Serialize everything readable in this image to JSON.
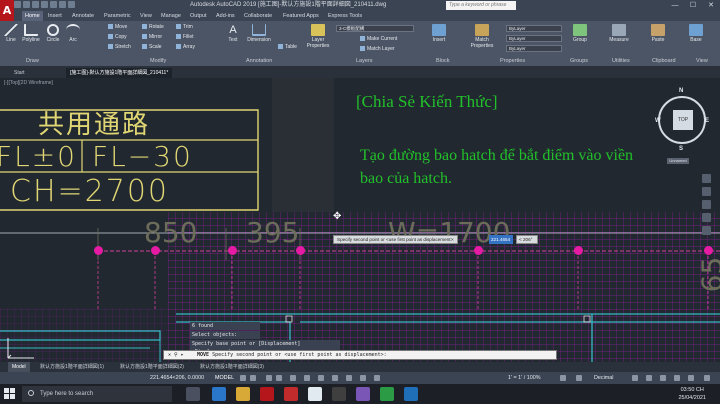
{
  "app": {
    "logo": "A",
    "title": "Autodesk AutoCAD 2019   [施工图]-默认方施設1階平面詳細図_210411.dwg",
    "search_placeholder": "Type a keyword or phrase",
    "window_controls": [
      "—",
      "☐",
      "✕"
    ]
  },
  "ribbon_tabs": [
    "Home",
    "Insert",
    "Annotate",
    "Parametric",
    "View",
    "Manage",
    "Output",
    "Add-ins",
    "Collaborate",
    "Featured Apps",
    "Express Tools"
  ],
  "ribbon": {
    "draw_tools": [
      "Line",
      "Polyline",
      "Circle",
      "Arc"
    ],
    "modify_tools": [
      "Move",
      "Rotate",
      "Trim",
      "Copy",
      "Mirror",
      "Fillet",
      "Stretch",
      "Scale",
      "Array"
    ],
    "annotation_tools": [
      "Text",
      "Dimension",
      "Table"
    ],
    "layer_tools": [
      "Layer Properties",
      "Make Current",
      "Match Layer"
    ],
    "layer_current": "3-C模板配構",
    "block_tool": "Insert",
    "properties_tool": "Match Properties",
    "bylayer": [
      "ByLayer",
      "ByLayer",
      "ByLayer"
    ],
    "group_tool": "Group",
    "utility_tool": "Measure",
    "clipboard_tool": "Paste",
    "base_tool": "Base",
    "panels": [
      "Draw",
      "Modify",
      "Annotation",
      "Layers",
      "Block",
      "Properties",
      "Groups",
      "Utilities",
      "Clipboard",
      "View"
    ]
  },
  "file_tabs": [
    "Start",
    "[施工图]-默认方施設1階平面詳細図_210411*"
  ],
  "drawing": {
    "view_label": "[-][Top][2D Wireframe]",
    "cad_title": "共用通路",
    "cad_fl0": "FL±0",
    "cad_fl30": "FL−30",
    "cad_ch": "CH=2700",
    "dim_850": "850",
    "dim_395": "395",
    "dim_w": "W=1700",
    "dim_65": "65",
    "annotation_title": "[Chia Sẻ Kiến Thức]",
    "annotation_body": "Tạo đường bao hatch để bắt điểm vào viền bao của hatch.",
    "viewcube": {
      "top": "TOP",
      "n": "N",
      "s": "S",
      "e": "E",
      "w": "W"
    },
    "wcs": "Unnamed",
    "tooltip": "Specify second point or <use first point as displacement>:",
    "dyn_distance": "221.4654",
    "dyn_angle": "< 206°"
  },
  "command_history": [
    "6 found",
    "Select objects:",
    "Specify base point or [Displacement] <Displacement>:"
  ],
  "command_line": {
    "command": "MOVE",
    "prompt": "Specify second point or <use first point as displacement>:"
  },
  "layout_tabs": [
    "Model",
    "默认方施設1階平面詳細図(1)",
    "默认方施設1階平面詳細図(2)",
    "默认方施設1階平面詳細図(3)"
  ],
  "status": {
    "coords": "221.4654<206, 0.0000",
    "model": "MODEL",
    "scale": "1' = 1'",
    "zoom": "100%",
    "units": "Decimal"
  },
  "taskbar": {
    "search": "Type here to search",
    "time": "03:50 CH",
    "date": "25/04/2021"
  },
  "colors": {
    "annotation": "#22c02a",
    "cad_text": "#e0d673",
    "grip": "#e51ba4",
    "hatch": "#b21fb4"
  }
}
